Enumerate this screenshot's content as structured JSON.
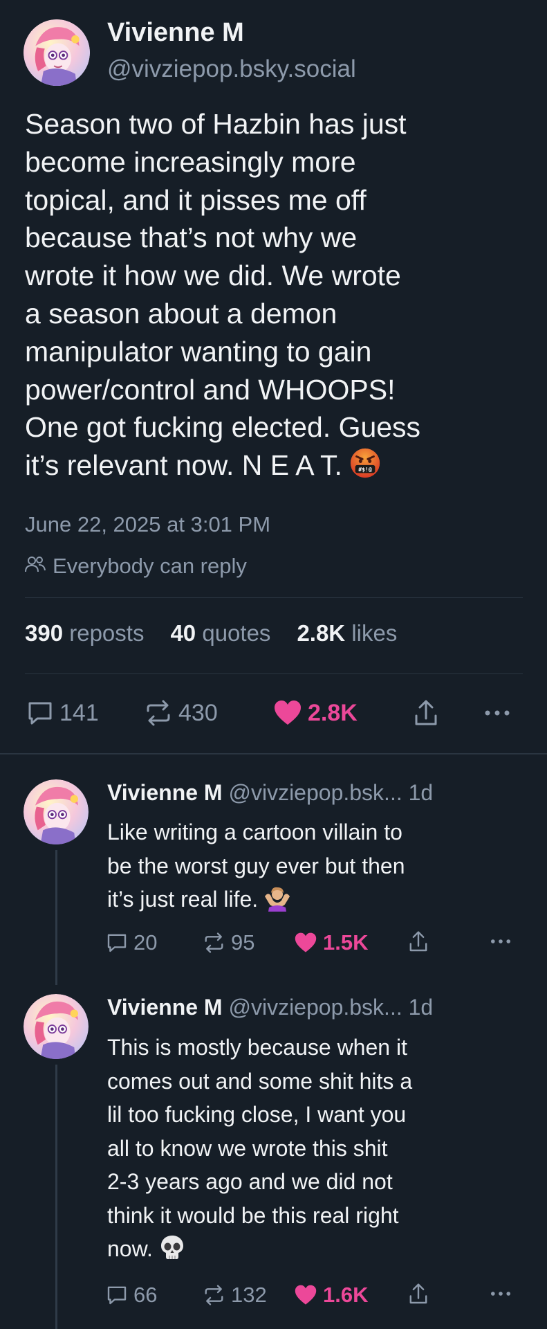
{
  "post": {
    "author": "Vivienne M",
    "handle": "@vivziepop.bsky.social",
    "text_lines": [
      "Season two of Hazbin has just",
      "become increasingly more",
      "topical, and it pisses me off",
      "because that’s not why we",
      "wrote it how we did. We wrote",
      "a season about a demon",
      "manipulator wanting to gain",
      "power/control and WHOOPS!",
      "One got fucking elected. Guess",
      "it’s relevant now. N E A T."
    ],
    "emoji_icon": "angry-face-with-symbols-icon",
    "timestamp": "June 22, 2025 at 3:01 PM",
    "reply_setting": "Everybody can reply",
    "stats": {
      "reposts_count": "390",
      "reposts_label": "reposts",
      "quotes_count": "40",
      "quotes_label": "quotes",
      "likes_count": "2.8K",
      "likes_label": "likes"
    },
    "actions": {
      "replies": "141",
      "reposts": "430",
      "likes": "2.8K"
    }
  },
  "replies": [
    {
      "author": "Vivienne M",
      "handle": "@vivziepop.bsk...",
      "time": "1d",
      "text_lines": [
        "Like writing a cartoon villain to",
        "be the worst guy ever but then",
        "it’s just real life."
      ],
      "emoji_icon": "person-shrugging-icon",
      "actions": {
        "replies": "20",
        "reposts": "95",
        "likes": "1.5K"
      }
    },
    {
      "author": "Vivienne M",
      "handle": "@vivziepop.bsk...",
      "time": "1d",
      "text_lines": [
        "This is mostly because when it",
        "comes out and some shit hits a",
        "lil too fucking close, I want you",
        "all to know we wrote this shit",
        "2-3 years ago and we did not",
        "think it would be this real right",
        "now."
      ],
      "emoji_icon": "skull-icon",
      "actions": {
        "replies": "66",
        "reposts": "132",
        "likes": "1.6K"
      }
    }
  ],
  "colors": {
    "background": "#161e27",
    "text": "#f1f3f5",
    "muted": "#8d9aab",
    "like": "#ec4899",
    "divider": "#2a3541"
  }
}
